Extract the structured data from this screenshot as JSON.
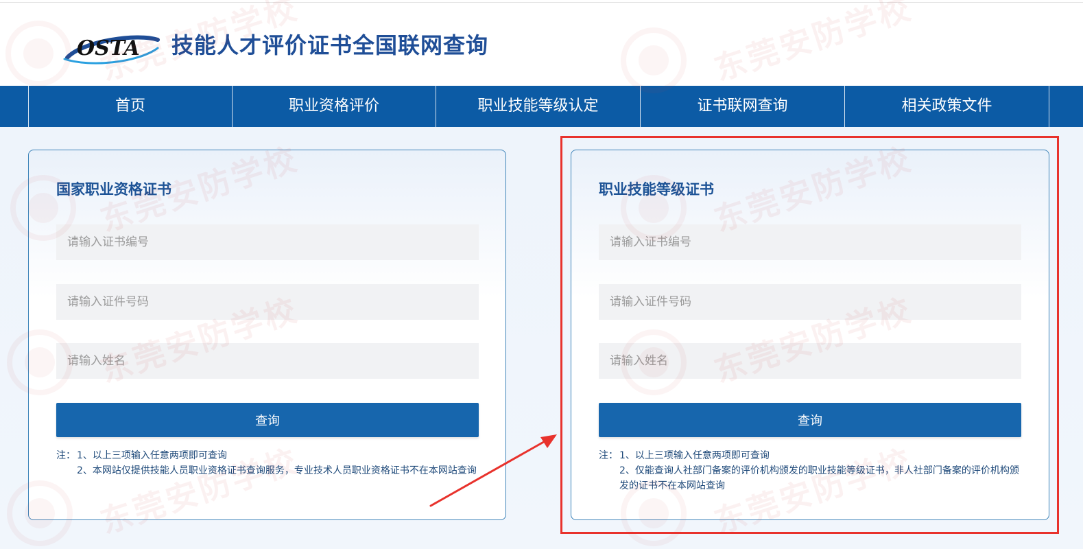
{
  "header": {
    "logo_text": "OSTA",
    "title": "技能人才评价证书全国联网查询"
  },
  "nav": {
    "items": [
      {
        "label": "首页"
      },
      {
        "label": "职业资格评价"
      },
      {
        "label": "职业技能等级认定"
      },
      {
        "label": "证书联网查询"
      },
      {
        "label": "相关政策文件"
      }
    ]
  },
  "watermark": {
    "text": "东莞安防学校"
  },
  "cards": [
    {
      "title": "国家职业资格证书",
      "fields": {
        "cert_no_placeholder": "请输入证书编号",
        "id_no_placeholder": "请输入证件号码",
        "name_placeholder": "请输入姓名"
      },
      "button_label": "查询",
      "notes": [
        {
          "prefix": "注：",
          "text": "1、以上三项输入任意两项即可查询"
        },
        {
          "prefix": "",
          "text": "2、本网站仅提供技能人员职业资格证书查询服务，专业技术人员职业资格证书不在本网站查询"
        }
      ]
    },
    {
      "title": "职业技能等级证书",
      "fields": {
        "cert_no_placeholder": "请输入证书编号",
        "id_no_placeholder": "请输入证件号码",
        "name_placeholder": "请输入姓名"
      },
      "button_label": "查询",
      "notes": [
        {
          "prefix": "注：",
          "text": "1、以上三项输入任意两项即可查询"
        },
        {
          "prefix": "",
          "text": "2、仅能查询人社部门备案的评价机构颁发的职业技能等级证书，非人社部门备案的评价机构颁发的证书不在本网站查询"
        }
      ]
    }
  ],
  "colors": {
    "nav_bg": "#0c5ba5",
    "title_blue": "#1f4e97",
    "button_bg": "#1766ad",
    "highlight_red": "#e8322c"
  }
}
